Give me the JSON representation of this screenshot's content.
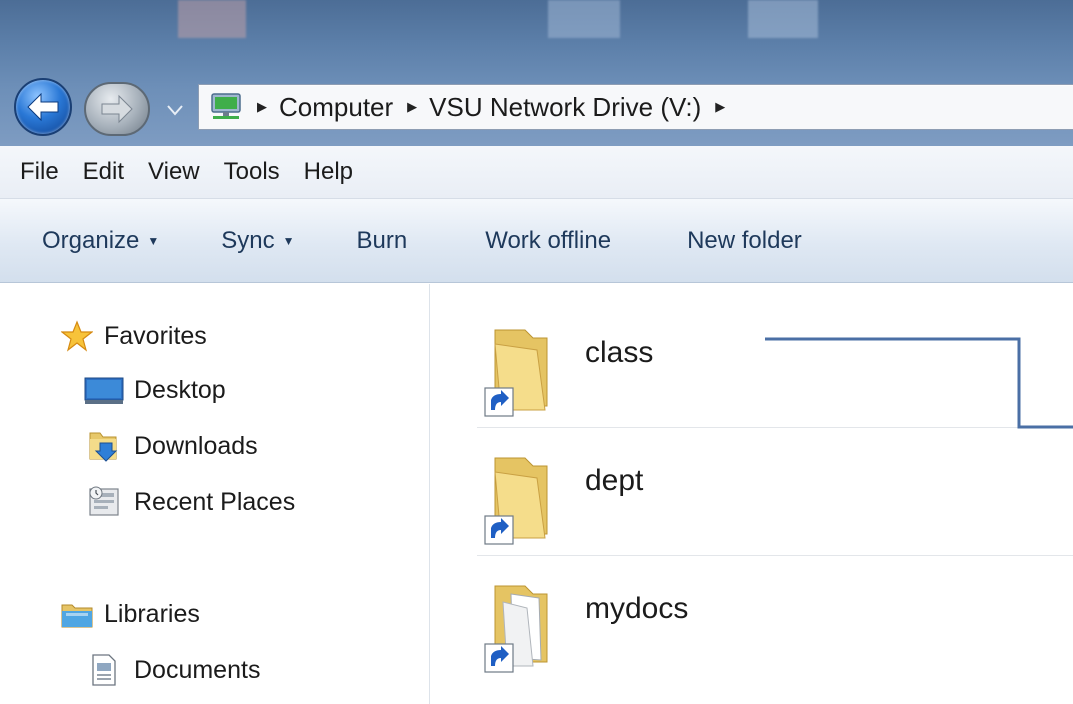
{
  "address": {
    "crumbs": [
      "Computer",
      "VSU Network Drive (V:)"
    ]
  },
  "menu": {
    "items": [
      "File",
      "Edit",
      "View",
      "Tools",
      "Help"
    ]
  },
  "commands": {
    "organize": "Organize",
    "sync": "Sync",
    "burn": "Burn",
    "work_offline": "Work offline",
    "new_folder": "New folder"
  },
  "nav": {
    "favorites": "Favorites",
    "desktop": "Desktop",
    "downloads": "Downloads",
    "recent_places": "Recent Places",
    "libraries": "Libraries",
    "documents": "Documents"
  },
  "files": [
    {
      "name": "class"
    },
    {
      "name": "dept"
    },
    {
      "name": "mydocs"
    }
  ],
  "icons": {
    "back": "back-arrow-icon",
    "forward": "forward-arrow-icon",
    "computer": "network-computer-icon",
    "favorites": "star-icon",
    "desktop": "desktop-icon",
    "downloads": "downloads-folder-icon",
    "recent": "recent-places-icon",
    "libraries": "libraries-icon",
    "documents": "document-icon",
    "shortcut_folder": "shortcut-folder-icon"
  },
  "colors": {
    "title_gradient": "#5c7fa9",
    "command_text": "#1e395b",
    "callout_line": "#4a6fa5"
  }
}
